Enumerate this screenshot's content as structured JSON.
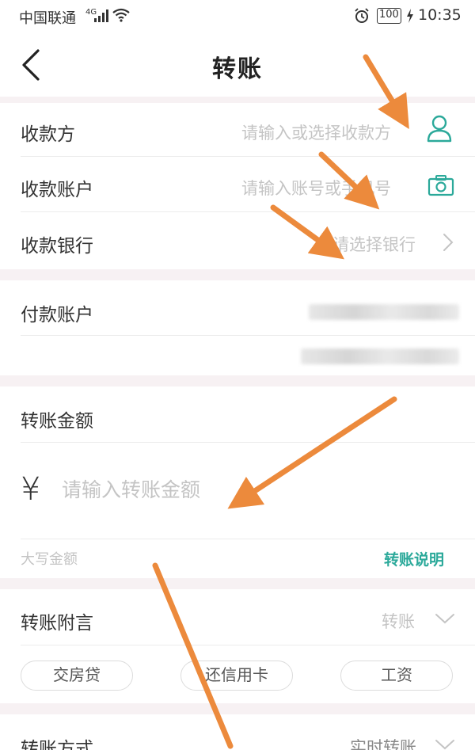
{
  "status_bar": {
    "carrier": "中国联通",
    "network": "4G",
    "battery": "100",
    "time": "10:35"
  },
  "header": {
    "title": "转账",
    "back_icon": "chevron-left-icon"
  },
  "payee": {
    "label": "收款方",
    "placeholder": "请输入或选择收款方",
    "icon": "contact-person-icon"
  },
  "payee_account": {
    "label": "收款账户",
    "placeholder": "请输入账号或手机号",
    "icon": "camera-icon"
  },
  "payee_bank": {
    "label": "收款银行",
    "placeholder": "请选择银行",
    "icon": "chevron-right-icon"
  },
  "payer_account": {
    "label": "付款账户"
  },
  "amount": {
    "label": "转账金额",
    "currency_symbol": "¥",
    "placeholder": "请输入转账金额",
    "uppercase_label": "大写金额",
    "help_link": "转账说明"
  },
  "memo": {
    "label": "转账附言",
    "value": "转账",
    "icon": "chevron-down-icon",
    "chips": [
      "交房贷",
      "还信用卡",
      "工资"
    ]
  },
  "method": {
    "label": "转账方式",
    "value": "实时转账",
    "icon": "chevron-down-icon"
  },
  "colors": {
    "accent": "#2ba99a",
    "annotation_arrow": "#ec8a3c",
    "section_gap": "#f7f1f3"
  }
}
